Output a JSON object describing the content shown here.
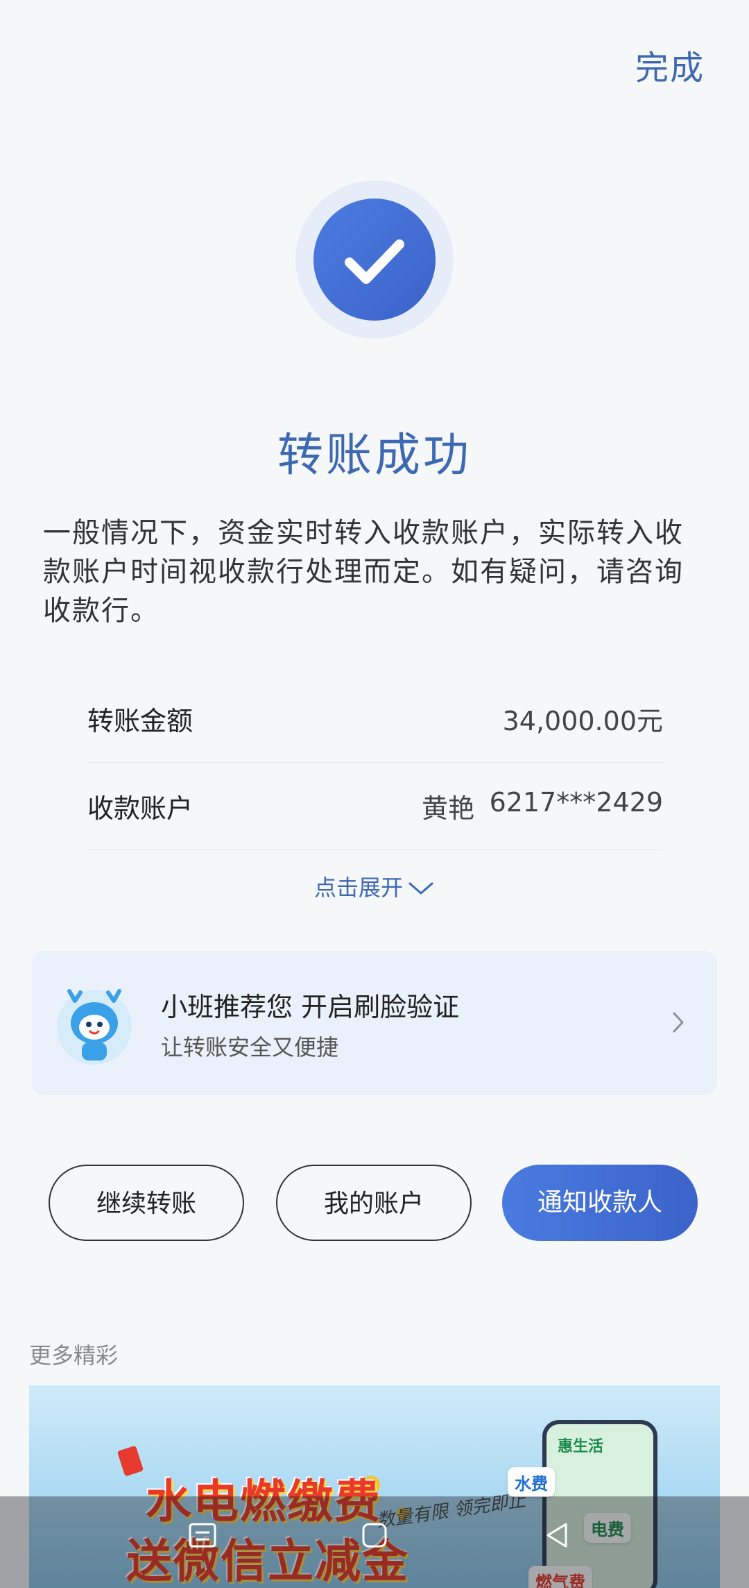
{
  "header": {
    "done_label": "完成"
  },
  "result": {
    "title": "转账成功",
    "notice": "一般情况下，资金实时转入收款账户，实际转入收款账户时间视收款行处理而定。如有疑问，请咨询收款行。",
    "icon": "check-icon"
  },
  "details": {
    "amount_label": "转账金额",
    "amount_value": "34,000.00元",
    "payee_label": "收款账户",
    "payee_name": "黄艳",
    "payee_account": "6217***2429",
    "expand_label": "点击展开"
  },
  "promo": {
    "title": "小班推荐您 开启刷脸验证",
    "subtitle": "让转账安全又便捷"
  },
  "actions": {
    "continue_label": "继续转账",
    "account_label": "我的账户",
    "notify_label": "通知收款人"
  },
  "more": {
    "section_label": "更多精彩",
    "banner_line1": "水电燃缴费",
    "banner_line2": "送微信立减金",
    "banner_script": "数量有限  领完即止",
    "banner_phone_tag": "惠生活",
    "banner_water": "水费",
    "banner_elec": "电费",
    "banner_gas": "燃气费"
  },
  "colors": {
    "accent": "#3d68b2",
    "primary_button": "#4a7be0",
    "background": "#f6f7f9",
    "card": "#ebf1fa"
  }
}
